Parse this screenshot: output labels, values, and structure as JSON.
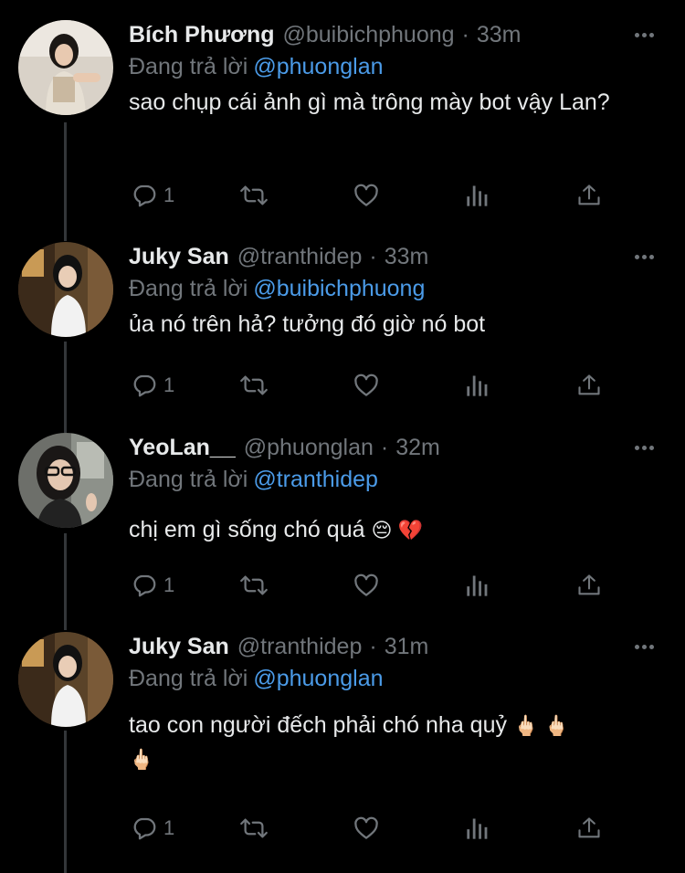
{
  "colors": {
    "background": "#000000",
    "text": "#e7e9ea",
    "muted": "#71767b",
    "link": "#4b9be8",
    "thread_line": "#333639"
  },
  "icons": [
    "reply-icon",
    "retweet-icon",
    "like-icon",
    "views-icon",
    "share-icon",
    "more-icon"
  ],
  "tweets": [
    {
      "name": "Bích Phương",
      "handle": "@buibichphuong",
      "dot": "·",
      "time": "33m",
      "reply_prefix": "Đang trả lời",
      "reply_to": "@phuonglan",
      "text": "sao chụp cái ảnh gì mà trông mày bot vậy Lan?",
      "emojis": "",
      "reply_count": "1"
    },
    {
      "name": "Juky San",
      "handle": "@tranthidep",
      "dot": "·",
      "time": "33m",
      "reply_prefix": "Đang trả lời",
      "reply_to": "@buibichphuong",
      "text": "ủa nó trên hả? tưởng đó giờ nó bot",
      "emojis": "",
      "reply_count": "1"
    },
    {
      "name": "YeoLan__",
      "handle": "@phuonglan",
      "dot": "·",
      "time": "32m",
      "reply_prefix": "Đang trả lời",
      "reply_to": "@tranthidep",
      "text": "chị em gì sống chó quá ",
      "emojis": "😔 💔",
      "reply_count": "1"
    },
    {
      "name": "Juky San",
      "handle": "@tranthidep",
      "dot": "·",
      "time": "31m",
      "reply_prefix": "Đang trả lời",
      "reply_to": "@phuonglan",
      "text": "tao con người đếch phải chó nha quỷ ",
      "emojis": "🖕🏻 🖕🏻\n🖕🏻",
      "reply_count": "1"
    }
  ]
}
